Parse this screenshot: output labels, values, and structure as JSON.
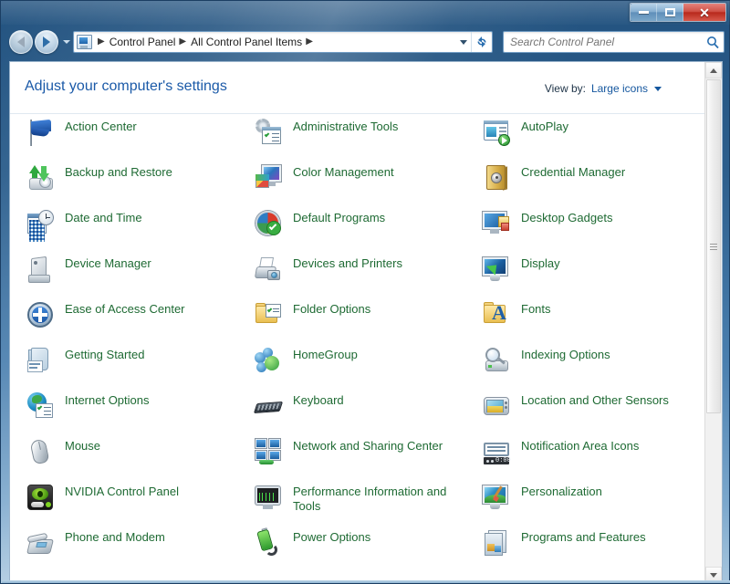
{
  "window": {
    "minimize_label": "Minimize",
    "maximize_label": "Maximize",
    "close_label": "Close"
  },
  "nav": {
    "back_label": "Back",
    "forward_label": "Forward",
    "recent_label": "Recent pages",
    "refresh_label": "Refresh",
    "breadcrumbs": [
      "Control Panel",
      "All Control Panel Items"
    ],
    "separator": "▶",
    "trailing_separator": "▶"
  },
  "search": {
    "placeholder": "Search Control Panel",
    "value": "",
    "icon": "search-icon"
  },
  "header": {
    "title": "Adjust your computer's settings",
    "view_by_label": "View by:",
    "view_by_value": "Large icons"
  },
  "columns": [
    [
      {
        "label": "Action Center",
        "icon": "flag-icon",
        "ic": "ic-flag"
      },
      {
        "label": "Backup and Restore",
        "icon": "backup-restore-icon",
        "ic": "ic-backup"
      },
      {
        "label": "Date and Time",
        "icon": "date-time-icon",
        "ic": "ic-date"
      },
      {
        "label": "Device Manager",
        "icon": "device-manager-icon",
        "ic": "ic-dev"
      },
      {
        "label": "Ease of Access Center",
        "icon": "ease-of-access-icon",
        "ic": "ic-ease"
      },
      {
        "label": "Getting Started",
        "icon": "getting-started-icon",
        "ic": "ic-gs"
      },
      {
        "label": "Internet Options",
        "icon": "internet-options-icon",
        "ic": "ic-inet"
      },
      {
        "label": "Mouse",
        "icon": "mouse-icon",
        "ic": "ic-mouse"
      },
      {
        "label": "NVIDIA Control Panel",
        "icon": "nvidia-icon",
        "ic": "ic-nv"
      },
      {
        "label": "Phone and Modem",
        "icon": "phone-modem-icon",
        "ic": "ic-phone"
      }
    ],
    [
      {
        "label": "Administrative Tools",
        "icon": "administrative-tools-icon",
        "ic": "ic-admin"
      },
      {
        "label": "Color Management",
        "icon": "color-management-icon",
        "ic": "ic-color"
      },
      {
        "label": "Default Programs",
        "icon": "default-programs-icon",
        "ic": "ic-defp"
      },
      {
        "label": "Devices and Printers",
        "icon": "devices-printers-icon",
        "ic": "ic-dp"
      },
      {
        "label": "Folder Options",
        "icon": "folder-options-icon",
        "ic": "ic-fo"
      },
      {
        "label": "HomeGroup",
        "icon": "homegroup-icon",
        "ic": "ic-hg"
      },
      {
        "label": "Keyboard",
        "icon": "keyboard-icon",
        "ic": "ic-kb"
      },
      {
        "label": "Network and Sharing Center",
        "icon": "network-sharing-icon",
        "ic": "ic-net"
      },
      {
        "label": "Performance Information and Tools",
        "icon": "performance-info-icon",
        "ic": "ic-perf"
      },
      {
        "label": "Power Options",
        "icon": "power-options-icon",
        "ic": "ic-pwr"
      }
    ],
    [
      {
        "label": "AutoPlay",
        "icon": "autoplay-icon",
        "ic": "ic-ap"
      },
      {
        "label": "Credential Manager",
        "icon": "credential-manager-icon",
        "ic": "ic-cm"
      },
      {
        "label": "Desktop Gadgets",
        "icon": "desktop-gadgets-icon",
        "ic": "ic-dg"
      },
      {
        "label": "Display",
        "icon": "display-icon",
        "ic": "ic-disp"
      },
      {
        "label": "Fonts",
        "icon": "fonts-icon",
        "ic": "ic-fonts"
      },
      {
        "label": "Indexing Options",
        "icon": "indexing-options-icon",
        "ic": "ic-idx"
      },
      {
        "label": "Location and Other Sensors",
        "icon": "location-sensors-icon",
        "ic": "ic-loc"
      },
      {
        "label": "Notification Area Icons",
        "icon": "notification-area-icon",
        "ic": "ic-nai"
      },
      {
        "label": "Personalization",
        "icon": "personalization-icon",
        "ic": "ic-per"
      },
      {
        "label": "Programs and Features",
        "icon": "programs-features-icon",
        "ic": "ic-pf"
      }
    ]
  ],
  "scrollbar": {
    "up_label": "Scroll up",
    "down_label": "Scroll down",
    "thumb_label": "Scroll thumb"
  },
  "colors": {
    "link_green": "#1e6a33",
    "header_blue": "#1b5aa8",
    "accent_blue": "#14569e",
    "frame_blue": "#2d5f8d",
    "close_red": "#b8291c"
  }
}
